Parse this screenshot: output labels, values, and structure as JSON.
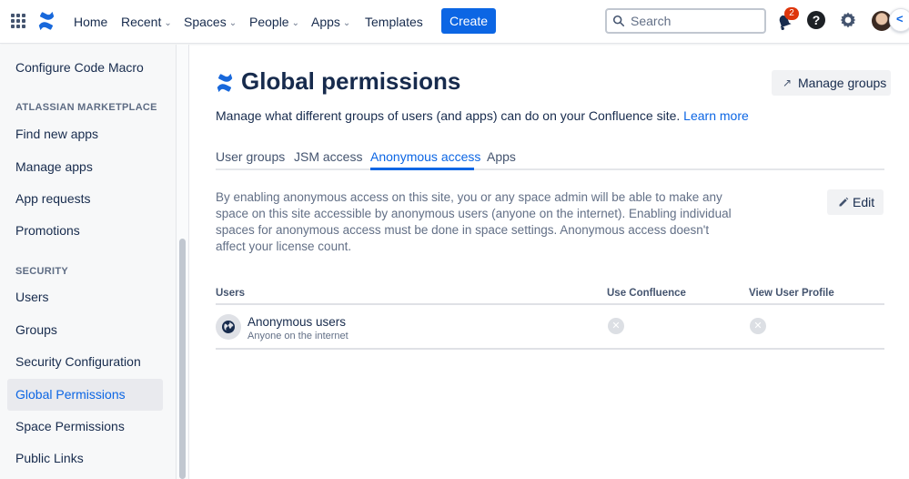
{
  "topnav": {
    "items": [
      {
        "label": "Home",
        "dropdown": false
      },
      {
        "label": "Recent",
        "dropdown": true
      },
      {
        "label": "Spaces",
        "dropdown": true
      },
      {
        "label": "People",
        "dropdown": true
      },
      {
        "label": "Apps",
        "dropdown": true
      },
      {
        "label": "Templates",
        "dropdown": false
      }
    ],
    "create_label": "Create",
    "search_placeholder": "Search",
    "notification_count": "2",
    "help_glyph": "?",
    "collapse_glyph": "<",
    "accent_color": "#0c66e4"
  },
  "sidebar": {
    "items_top": [
      {
        "label": "Configure Code Macro"
      }
    ],
    "heading_marketplace": "ATLASSIAN MARKETPLACE",
    "marketplace_items": [
      {
        "label": "Find new apps"
      },
      {
        "label": "Manage apps"
      },
      {
        "label": "App requests"
      },
      {
        "label": "Promotions"
      }
    ],
    "heading_security": "SECURITY",
    "security_items": [
      {
        "label": "Users"
      },
      {
        "label": "Groups"
      },
      {
        "label": "Security Configuration"
      },
      {
        "label": "Global Permissions",
        "active": true
      },
      {
        "label": "Space Permissions"
      },
      {
        "label": "Public Links"
      }
    ]
  },
  "main": {
    "title": "Global permissions",
    "manage_groups_label": "Manage groups",
    "description": "Manage what different groups of users (and apps) can do on your Confluence site.",
    "learn_more": "Learn more",
    "tabs": [
      {
        "label": "User groups"
      },
      {
        "label": "JSM access"
      },
      {
        "label": "Anonymous access",
        "active": true
      },
      {
        "label": "Apps"
      }
    ],
    "info_text": "By enabling anonymous access on this site, you or any space admin will be able to make any space on this site accessible by anonymous users (anyone on the internet). Enabling individual spaces for anonymous access must be done in space settings. Anonymous access doesn't affect your license count.",
    "edit_label": "Edit",
    "table": {
      "headers": [
        "Users",
        "Use Confluence",
        "View User Profile"
      ],
      "rows": [
        {
          "name": "Anonymous users",
          "subtitle": "Anyone on the internet",
          "use_confluence": "denied",
          "view_user_profile": "denied"
        }
      ]
    }
  }
}
